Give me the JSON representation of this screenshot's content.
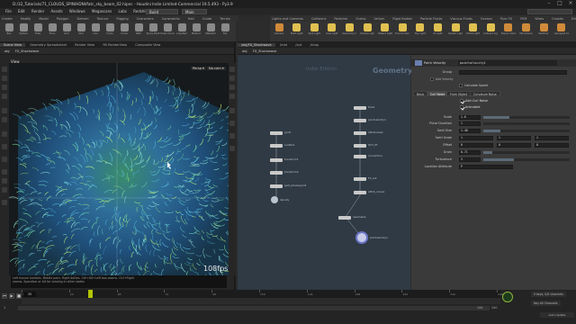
{
  "window": {
    "title": "D:/32_Tutorials/71_CLOUDS_SPIN/HDNI/fatc_sky_beam_02.hipnc - Houdini Indie Limited-Commercial 19.5.493 - Py3.9"
  },
  "menu": {
    "items": [
      "File",
      "Edit",
      "Render",
      "Assets",
      "Windows",
      "Megascans",
      "Labs",
      "Redshift",
      "Help"
    ],
    "desktop": "Build",
    "main_label": "Main"
  },
  "shelf": {
    "left_tabs": [
      "Create",
      "Modify",
      "Model",
      "Polygon",
      "Deform",
      "Texture",
      "Rigging",
      "Characters",
      "Constraints",
      "Hair",
      "Guide",
      "Terrain",
      "Simple FX"
    ],
    "right_tabs": [
      "Lights and Cameras",
      "Collisions",
      "Particles",
      "Grains",
      "Vellum",
      "Rigid Bodies",
      "Particle Fluids",
      "Viscous Fluids",
      "Oceans",
      "Pyro FX",
      "FEM",
      "Wires",
      "Crowds",
      "Drive Simulation"
    ],
    "left_tools": [
      {
        "label": "Box",
        "color": "#8a8a8a"
      },
      {
        "label": "Sphere",
        "color": "#8a8a8a"
      },
      {
        "label": "Tube",
        "color": "#8a8a8a"
      },
      {
        "label": "Torus",
        "color": "#8a8a8a"
      },
      {
        "label": "Grid",
        "color": "#8a8a8a"
      },
      {
        "label": "Null",
        "color": "#8a8a8a"
      },
      {
        "label": "Line",
        "color": "#8a8a8a"
      },
      {
        "label": "Circle",
        "color": "#8a8a8a"
      },
      {
        "label": "Curve",
        "color": "#8a8a8a"
      },
      {
        "label": "Path",
        "color": "#8a8a8a"
      },
      {
        "label": "Spray Paint",
        "color": "#8a8a8a"
      },
      {
        "label": "Draw Curve",
        "color": "#8a8a8a"
      },
      {
        "label": "L-System",
        "color": "#8a8a8a"
      },
      {
        "label": "Platonic",
        "color": "#8a8a8a"
      },
      {
        "label": "Metaball",
        "color": "#8a8a8a"
      },
      {
        "label": "File",
        "color": "#8a8a8a"
      }
    ],
    "right_tools": [
      {
        "label": "Camera",
        "color": "#d08a3a"
      },
      {
        "label": "Point Light",
        "color": "#e0c050"
      },
      {
        "label": "Spot Light",
        "color": "#e0c050"
      },
      {
        "label": "Area Light",
        "color": "#e0c050"
      },
      {
        "label": "Geometry Light",
        "color": "#e0c050"
      },
      {
        "label": "Volume Light",
        "color": "#e0c050"
      },
      {
        "label": "Distant Light",
        "color": "#e0c050"
      },
      {
        "label": "Environment Light",
        "color": "#e0c050"
      },
      {
        "label": "Sky Light",
        "color": "#e0c050"
      },
      {
        "label": "GI Light",
        "color": "#e0c050"
      },
      {
        "label": "Caustic Light",
        "color": "#e0c050"
      },
      {
        "label": "Portal Light",
        "color": "#e0c050"
      },
      {
        "label": "Ambient Light",
        "color": "#e0c050"
      },
      {
        "label": "Stereo Camera",
        "color": "#d08a3a"
      },
      {
        "label": "VR Camera",
        "color": "#d08a3a"
      },
      {
        "label": "Switcher",
        "color": "#d08a3a"
      },
      {
        "label": "Gamepad Camera",
        "color": "#d08a3a"
      }
    ]
  },
  "left_pane": {
    "tabs": [
      "Scene View",
      "Geometry Spreadsheet",
      "Render View",
      "RS RenderView",
      "Composite View"
    ],
    "path": [
      "obj",
      "FX_Shockwave"
    ],
    "viewport_title": "View",
    "persp": "Persp ▾",
    "camera": "No cam ▾",
    "fps": "108fps",
    "status": [
      "Left mouse tumbles. Middle pans. Right dollies. Ctrl+Alt+Left box-zooms. Ctrl+Right",
      "zooms. Spacebar or Alt for viewing in other states"
    ]
  },
  "right_pane": {
    "tabs": [
      "/obj/FX_Shockwave",
      "/mat",
      "/out",
      "/shop"
    ],
    "path": [
      "obj",
      "FX_Shockwave"
    ],
    "network_bg_label": "Indie Edition",
    "network_type": "Geometry",
    "nodes": [
      {
        "id": "grid1",
        "label": "grid1"
      },
      {
        "id": "scatter1",
        "label": "scatter1"
      },
      {
        "id": "transform1",
        "label": "transform1"
      },
      {
        "id": "transform2",
        "label": "transform2"
      },
      {
        "id": "splitvar",
        "label": "split_ptrelaxgrid1"
      },
      {
        "id": "density",
        "label": "density"
      },
      {
        "id": "trail1",
        "label": "trail1"
      },
      {
        "id": "pointvelocity",
        "label": "pointvelocity1"
      },
      {
        "id": "attrnoise",
        "label": "attribnoise1"
      },
      {
        "id": "null",
        "label": "OUT_PT"
      },
      {
        "id": "convert",
        "label": "convertline"
      },
      {
        "id": "fx_out",
        "label": "FX_out"
      },
      {
        "id": "attrib",
        "label": "attrib_noise1"
      },
      {
        "id": "merge1",
        "label": "merge1"
      },
      {
        "id": "resample",
        "label": "resample1"
      },
      {
        "id": "tube",
        "label": "pointvelocity1"
      }
    ]
  },
  "params": {
    "node_type": "Point Velocity",
    "node_name": "pointvelocity1",
    "group_label": "Group",
    "add_velocity_label": "Add Velocity",
    "calculate_speed_label": "Calculate Speed",
    "tabs": [
      "Basic",
      "Curl Noise",
      "From Object",
      "Curvature Noise"
    ],
    "active_tab": "Curl Noise",
    "add_curl_noise": "Add Curl Noise",
    "animated": "Animated",
    "rows": [
      {
        "label": "Scale",
        "value": "1.6",
        "fill": 0.3
      },
      {
        "label": "Pulse Duration",
        "value": "1",
        "fill": 0.0
      },
      {
        "label": "Swirl Size",
        "value": "1.48",
        "fill": 0.2
      },
      {
        "label": "Swirl Scale",
        "value": "1",
        "fill": 0.0
      },
      {
        "label": "Offset",
        "value": "0",
        "fill": 0.0
      },
      {
        "label": "Grain",
        "value": "0.71",
        "fill": 0.1
      },
      {
        "label": "Turbulence",
        "value": "3",
        "fill": 0.35
      },
      {
        "label": "Location Attribute",
        "value": "P",
        "fill": 0.0
      }
    ],
    "swirl_scale_extra": [
      "1",
      "1"
    ],
    "offset_extra": [
      "0",
      "0"
    ]
  },
  "timeline": {
    "frame": "35",
    "ticks": [
      "1",
      "24",
      "48",
      "72",
      "96",
      "120",
      "144",
      "168",
      "192",
      "216",
      "240"
    ],
    "start": "1",
    "end": "144",
    "end2": "240",
    "keys": "0 keys, 0/0 channels",
    "key_all": "Key All Channels",
    "auto_update": "Auto Update",
    "playhead_fraction": 0.14
  }
}
